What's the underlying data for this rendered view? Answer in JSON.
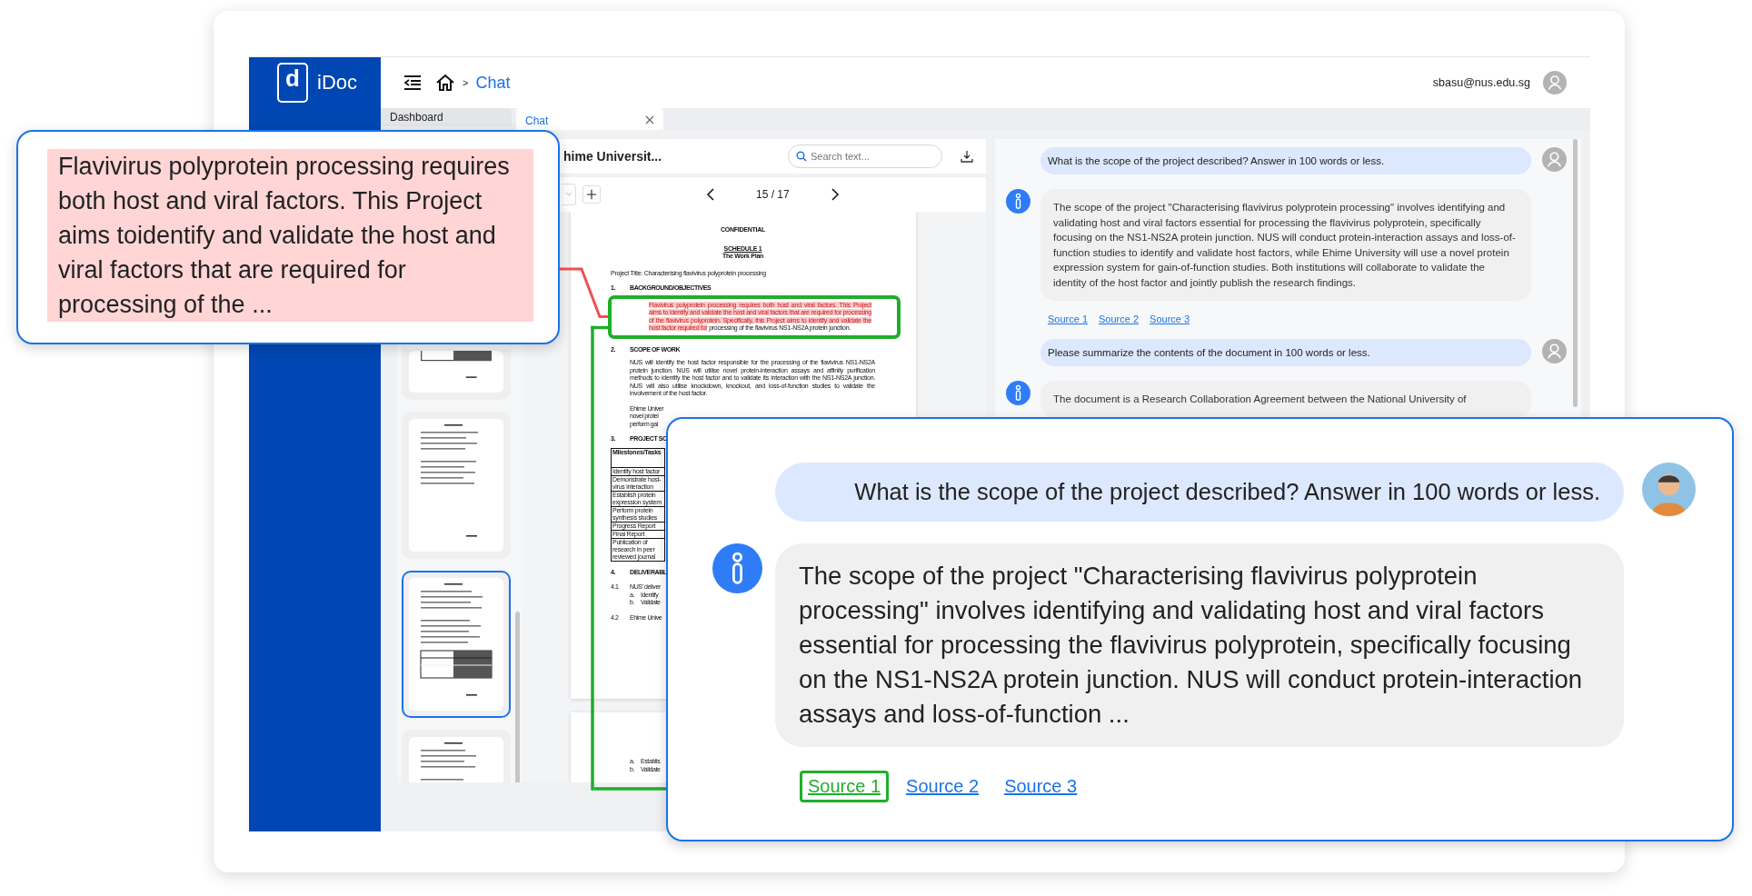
{
  "sidebar": {
    "logo_glyph": "d",
    "logo_text": "iDoc"
  },
  "header": {
    "breadcrumb_separator": ">",
    "breadcrumb_current": "Chat",
    "user_email": "sbasu@nus.edu.sg"
  },
  "tabs": [
    {
      "label": "Dashboard",
      "selected": false,
      "closable": false
    },
    {
      "label": "Chat",
      "selected": true,
      "closable": true
    }
  ],
  "document_viewer": {
    "title": "hime Universit...",
    "search": {
      "placeholder": "Search text..."
    },
    "page_indicator": "15 / 17",
    "thumbnails": [
      {
        "selected": false
      },
      {
        "selected": false
      },
      {
        "selected": true
      },
      {
        "selected": false
      }
    ],
    "page": {
      "header": "CONFIDENTIAL",
      "schedule": "SCHEDULE 1",
      "subtitle": "The Work Plan",
      "project_title": "Project Title: Characterising flavivirus polyprotein processing",
      "blocks": [
        {
          "kind": "heading",
          "number": "1.",
          "text": "BACKGROUND/OBJECTIVES"
        },
        {
          "kind": "paragraph",
          "highlighted_text": "Flavivirus polyprotein processing requires both host and viral factors. This Project aims to identify and validate the host and viral factors that are required for processing of the flavivirus polyprotein. Specifically, this Project aims to identify and validate the host factor required for",
          "text": "processing of the flavivirus NS1-NS2A protein junction."
        },
        {
          "kind": "heading",
          "number": "2.",
          "text": "SCOPE OF WORK"
        },
        {
          "kind": "paragraph",
          "text": "NUS will identify the host factor responsible for the processing of the flavivirus NS1-NS2A protein junction. NUS will utilise novel protein-interaction assays and affinity purification methods to identify the host factor and to validate its interaction with the NS1-NS2A junction. NUS will also utilise knockdown, knockout, and loss-of-function studies to validate the involvement of the host factor."
        },
        {
          "kind": "cut_paragraph",
          "lines": [
            "Ehime Univer",
            "novel protei",
            "perform gai"
          ]
        },
        {
          "kind": "heading",
          "number": "3.",
          "text": "PROJECT SC"
        },
        {
          "kind": "table",
          "header": "Milestones/Tasks",
          "rows": [
            "Identify host factor",
            "Demonstrate host-virus interaction",
            "Establish protein expression system",
            "Perform protein synthesis studies",
            "Progress Report",
            "Final Report",
            "Publication of research in peer reviewed journal"
          ]
        },
        {
          "kind": "heading",
          "number": "4.",
          "text": "DELIVERABL"
        },
        {
          "kind": "item",
          "number": "4.1",
          "text": "NUS' deliver"
        },
        {
          "kind": "subitem",
          "number": "a.",
          "text": "Identify"
        },
        {
          "kind": "subitem",
          "number": "b.",
          "text": "Validate"
        },
        {
          "kind": "item",
          "number": "4.2",
          "text": "Ehime Unive"
        }
      ]
    },
    "next_page": {
      "blocks": [
        {
          "kind": "subitem",
          "number": "a.",
          "text": "Establis"
        },
        {
          "kind": "subitem",
          "number": "b.",
          "text": "Validate"
        }
      ]
    }
  },
  "chat": {
    "messages": [
      {
        "kind": "user",
        "text": "What is the scope of the project described? Answer in 100 words or less."
      },
      {
        "kind": "assistant",
        "text": "The scope of the project \"Characterising flavivirus polyprotein processing\" involves identifying and validating host and viral factors essential for processing the flavivirus polyprotein, specifically focusing on the NS1-NS2A protein junction. NUS will conduct protein-interaction assays and loss-of-function studies to identify and validate host factors, while Ehime University will use a novel protein expression system for gain-of-function studies. Both institutions will collaborate to validate the identity of the host factor and jointly publish the research findings.",
        "sources": [
          "Source 1",
          "Source 2",
          "Source 3"
        ]
      },
      {
        "kind": "user",
        "text": "Please summarize the contents of the document in 100 words or less."
      },
      {
        "kind": "assistant",
        "text": "The document is a Research Collaboration Agreement between the National University of"
      }
    ]
  },
  "excerpt_callout": {
    "text": "Flavivirus polyprotein processing requires both host and viral factors. This Project aims toidentify and validate the host and viral factors that are required for processing of the ..."
  },
  "chat_callout": {
    "question": "What is the scope of the project described? Answer in 100 words or less.",
    "answer": "The scope of the project \"Characterising flavivirus polyprotein processing\" involves identifying and validating host and viral factors essential for processing the flavivirus polyprotein, specifically focusing on the NS1-NS2A protein junction. NUS will conduct protein-interaction assays and loss-of-function ...",
    "sources": [
      {
        "label": "Source 1",
        "selected": true
      },
      {
        "label": "Source 2",
        "selected": false
      },
      {
        "label": "Source 3",
        "selected": false
      }
    ]
  }
}
